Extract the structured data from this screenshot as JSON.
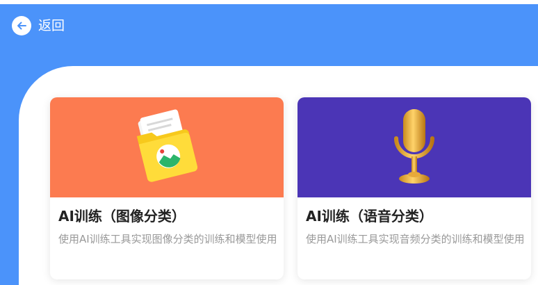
{
  "header": {
    "back_label": "返回",
    "background_color": "#4B93FA"
  },
  "cards": [
    {
      "title": "AI训练（图像分类）",
      "description": "使用AI训练工具实现图像分类的训练和模型使用",
      "banner_color": "#FC7B50",
      "icon": "folder-image-icon"
    },
    {
      "title": "AI训练（语音分类）",
      "description": "使用AI训练工具实现音频分类的训练和模型使用",
      "banner_color": "#4B35B6",
      "icon": "microphone-icon"
    }
  ]
}
